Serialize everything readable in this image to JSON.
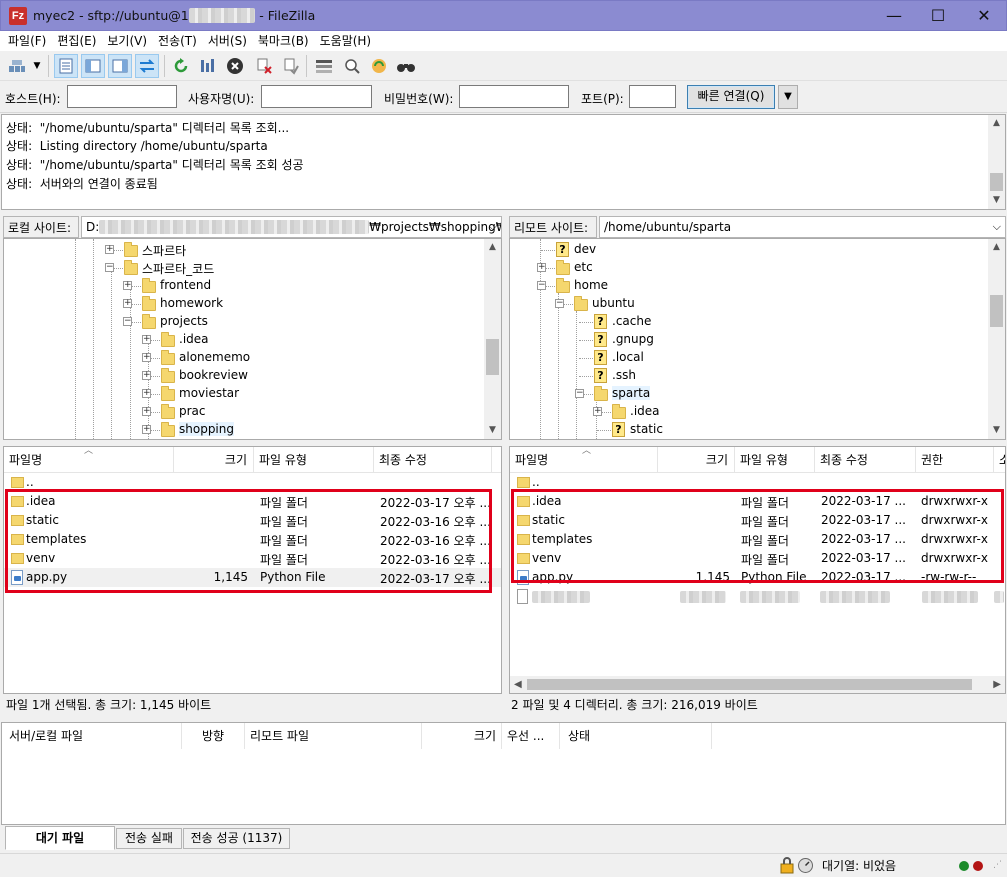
{
  "window": {
    "app_icon": "Fz",
    "title_prefix": "myec2 - sftp://ubuntu@1",
    "title_hidden": "xxxxxxxxx",
    "title_suffix": " - FileZilla",
    "minimize": "—",
    "maximize": "☐",
    "close": "✕"
  },
  "menu": [
    "파일(F)",
    "편집(E)",
    "보기(V)",
    "전송(T)",
    "서버(S)",
    "북마크(B)",
    "도움말(H)"
  ],
  "quickconnect": {
    "host_label": "호스트(H):",
    "user_label": "사용자명(U):",
    "pass_label": "비밀번호(W):",
    "port_label": "포트(P):",
    "host_value": "",
    "user_value": "",
    "pass_value": "",
    "port_value": "",
    "connect_button": "빠른 연결(Q)",
    "dropdown": "▼"
  },
  "log": [
    {
      "label": "상태:",
      "text": "\"/home/ubuntu/sparta\" 디렉터리 목록 조회..."
    },
    {
      "label": "상태:",
      "text": "Listing directory /home/ubuntu/sparta"
    },
    {
      "label": "상태:",
      "text": "\"/home/ubuntu/sparta\" 디렉터리 목록 조회 성공"
    },
    {
      "label": "상태:",
      "text": "서버와의 연결이 종료됨"
    }
  ],
  "local": {
    "site_label": "로컬 사이트:",
    "path_prefix": "D:",
    "path_hidden": "xxxxxxxxxxxxxxxxxxxxxxxxxxxxxxxxxxxxxx",
    "path_suffix": "₩projects₩shopping₩",
    "tree": [
      {
        "name": "스파르타",
        "icon": "folder-icon",
        "exp": "+"
      },
      {
        "name": "스파르타_코드",
        "icon": "folder-icon",
        "exp": "−"
      },
      {
        "name": "frontend",
        "icon": "folder-icon",
        "exp": "+"
      },
      {
        "name": "homework",
        "icon": "folder-icon",
        "exp": "+"
      },
      {
        "name": "projects",
        "icon": "folder-icon",
        "exp": "−"
      },
      {
        "name": ".idea",
        "icon": "folder-icon",
        "exp": "+"
      },
      {
        "name": "alonememo",
        "icon": "folder-icon",
        "exp": "+"
      },
      {
        "name": "bookreview",
        "icon": "folder-icon",
        "exp": "+"
      },
      {
        "name": "moviestar",
        "icon": "folder-icon",
        "exp": "+"
      },
      {
        "name": "prac",
        "icon": "folder-icon",
        "exp": "+"
      },
      {
        "name": "shopping",
        "icon": "folder-icon",
        "exp": "+"
      }
    ],
    "headers": [
      "파일명",
      "크기",
      "파일 유형",
      "최종 수정"
    ],
    "files": [
      {
        "name": "..",
        "size": "",
        "type": "",
        "modified": "",
        "icon": "folder-icon"
      },
      {
        "name": ".idea",
        "size": "",
        "type": "파일 폴더",
        "modified": "2022-03-17 오후 ...",
        "icon": "folder-icon"
      },
      {
        "name": "static",
        "size": "",
        "type": "파일 폴더",
        "modified": "2022-03-16 오후 ...",
        "icon": "folder-icon"
      },
      {
        "name": "templates",
        "size": "",
        "type": "파일 폴더",
        "modified": "2022-03-16 오후 ...",
        "icon": "folder-icon"
      },
      {
        "name": "venv",
        "size": "",
        "type": "파일 폴더",
        "modified": "2022-03-16 오후 ...",
        "icon": "folder-icon"
      },
      {
        "name": "app.py",
        "size": "1,145",
        "type": "Python File",
        "modified": "2022-03-17 오후 ...",
        "icon": "python-file-icon"
      }
    ],
    "status": "파일 1개 선택됨. 총 크기: 1,145 바이트"
  },
  "remote": {
    "site_label": "리모트 사이트:",
    "path": "/home/ubuntu/sparta",
    "tree": [
      {
        "name": "dev",
        "icon": "unknown-folder-icon",
        "exp": ""
      },
      {
        "name": "etc",
        "icon": "folder-icon",
        "exp": "+"
      },
      {
        "name": "home",
        "icon": "folder-icon",
        "exp": "−"
      },
      {
        "name": "ubuntu",
        "icon": "folder-icon",
        "exp": "−"
      },
      {
        "name": ".cache",
        "icon": "unknown-folder-icon",
        "exp": ""
      },
      {
        "name": ".gnupg",
        "icon": "unknown-folder-icon",
        "exp": ""
      },
      {
        "name": ".local",
        "icon": "unknown-folder-icon",
        "exp": ""
      },
      {
        "name": ".ssh",
        "icon": "unknown-folder-icon",
        "exp": ""
      },
      {
        "name": "sparta",
        "icon": "folder-icon",
        "exp": "−"
      },
      {
        "name": ".idea",
        "icon": "folder-icon",
        "exp": "+"
      },
      {
        "name": "static",
        "icon": "unknown-folder-icon",
        "exp": ""
      }
    ],
    "headers": [
      "파일명",
      "크기",
      "파일 유형",
      "최종 수정",
      "권한",
      "소"
    ],
    "files": [
      {
        "name": "..",
        "size": "",
        "type": "",
        "modified": "",
        "perm": "",
        "icon": "folder-icon"
      },
      {
        "name": ".idea",
        "size": "",
        "type": "파일 폴더",
        "modified": "2022-03-17 ...",
        "perm": "drwxrwxr-x",
        "icon": "folder-icon"
      },
      {
        "name": "static",
        "size": "",
        "type": "파일 폴더",
        "modified": "2022-03-17 ...",
        "perm": "drwxrwxr-x",
        "icon": "folder-icon"
      },
      {
        "name": "templates",
        "size": "",
        "type": "파일 폴더",
        "modified": "2022-03-17 ...",
        "perm": "drwxrwxr-x",
        "icon": "folder-icon"
      },
      {
        "name": "venv",
        "size": "",
        "type": "파일 폴더",
        "modified": "2022-03-17 ...",
        "perm": "drwxrwxr-x",
        "icon": "folder-icon"
      },
      {
        "name": "app.py",
        "size": "1,145",
        "type": "Python File",
        "modified": "2022-03-17 ...",
        "perm": "-rw-rw-r--",
        "icon": "python-file-icon"
      }
    ],
    "status": "2 파일 및 4 디렉터리. 총 크기: 216,019 바이트"
  },
  "queue": {
    "headers": [
      "서버/로컬 파일",
      "방향",
      "리모트 파일",
      "크기",
      "우선 ...",
      "상태"
    ]
  },
  "tabs": [
    "대기 파일",
    "전송 실패",
    "전송 성공 (1137)"
  ],
  "bottom": {
    "queue_status": "대기열: 비었음"
  },
  "colors": {
    "titlebar": "#8b8bd1",
    "highlight": "#e0001a",
    "folder": "#f5d76e"
  }
}
